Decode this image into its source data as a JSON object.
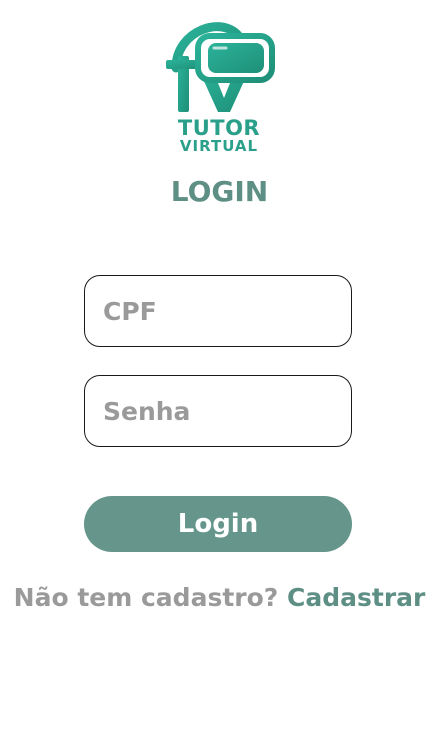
{
  "brand": {
    "line1": "TUTOR",
    "line2": "VIRTUAL",
    "logo_icon": "vr-headset-tv-logo",
    "color": "#2aa08a"
  },
  "page": {
    "title": "LOGIN",
    "title_color": "#5e8f85"
  },
  "form": {
    "cpf": {
      "value": "",
      "placeholder": "CPF"
    },
    "senha": {
      "value": "",
      "placeholder": "Senha"
    },
    "submit_label": "Login",
    "submit_color": "#65958b"
  },
  "signup": {
    "prompt": "Não tem cadastro?",
    "link_label": "Cadastrar"
  }
}
